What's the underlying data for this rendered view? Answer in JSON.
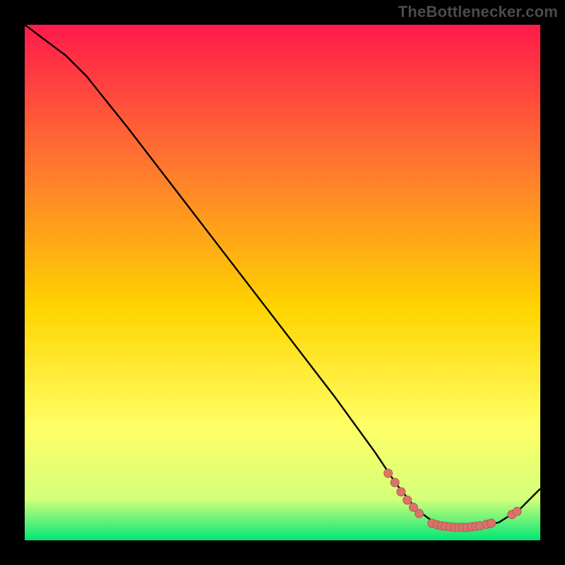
{
  "watermark": "TheBottlenecker.com",
  "colors": {
    "bg_black": "#000000",
    "grad_top": "#ff1a4b",
    "grad_mid_upper": "#ff7a2e",
    "grad_mid": "#ffd400",
    "grad_mid_lower": "#ffff66",
    "grad_near_bottom": "#d4ff7a",
    "grad_bottom": "#00e676",
    "curve": "#000000",
    "marker_fill": "#d9746b",
    "marker_stroke": "#b45a52"
  },
  "chart_data": {
    "type": "line",
    "title": "",
    "xlabel": "",
    "ylabel": "",
    "xlim": [
      0,
      100
    ],
    "ylim": [
      0,
      100
    ],
    "grid": false,
    "legend": false,
    "series": [
      {
        "name": "curve",
        "x": [
          0,
          4,
          8,
          12,
          20,
          30,
          40,
          50,
          60,
          68,
          72,
          76,
          80,
          84,
          88,
          92,
          96,
          100
        ],
        "y": [
          100,
          97,
          94,
          90,
          80,
          67,
          54,
          41,
          28,
          17,
          11,
          6,
          3,
          2.5,
          2.5,
          3.5,
          6,
          10
        ]
      }
    ],
    "markers": [
      {
        "x": 70.5,
        "y": 13.0
      },
      {
        "x": 71.8,
        "y": 11.2
      },
      {
        "x": 73.0,
        "y": 9.4
      },
      {
        "x": 74.2,
        "y": 7.8
      },
      {
        "x": 75.4,
        "y": 6.4
      },
      {
        "x": 76.5,
        "y": 5.2
      },
      {
        "x": 79.0,
        "y": 3.3
      },
      {
        "x": 80.0,
        "y": 3.0
      },
      {
        "x": 80.8,
        "y": 2.8
      },
      {
        "x": 81.6,
        "y": 2.7
      },
      {
        "x": 82.5,
        "y": 2.6
      },
      {
        "x": 83.4,
        "y": 2.5
      },
      {
        "x": 84.2,
        "y": 2.5
      },
      {
        "x": 85.0,
        "y": 2.5
      },
      {
        "x": 85.8,
        "y": 2.5
      },
      {
        "x": 86.7,
        "y": 2.6
      },
      {
        "x": 87.5,
        "y": 2.7
      },
      {
        "x": 88.3,
        "y": 2.8
      },
      {
        "x": 89.6,
        "y": 3.1
      },
      {
        "x": 90.5,
        "y": 3.3
      },
      {
        "x": 94.5,
        "y": 5.0
      },
      {
        "x": 95.5,
        "y": 5.6
      }
    ]
  }
}
